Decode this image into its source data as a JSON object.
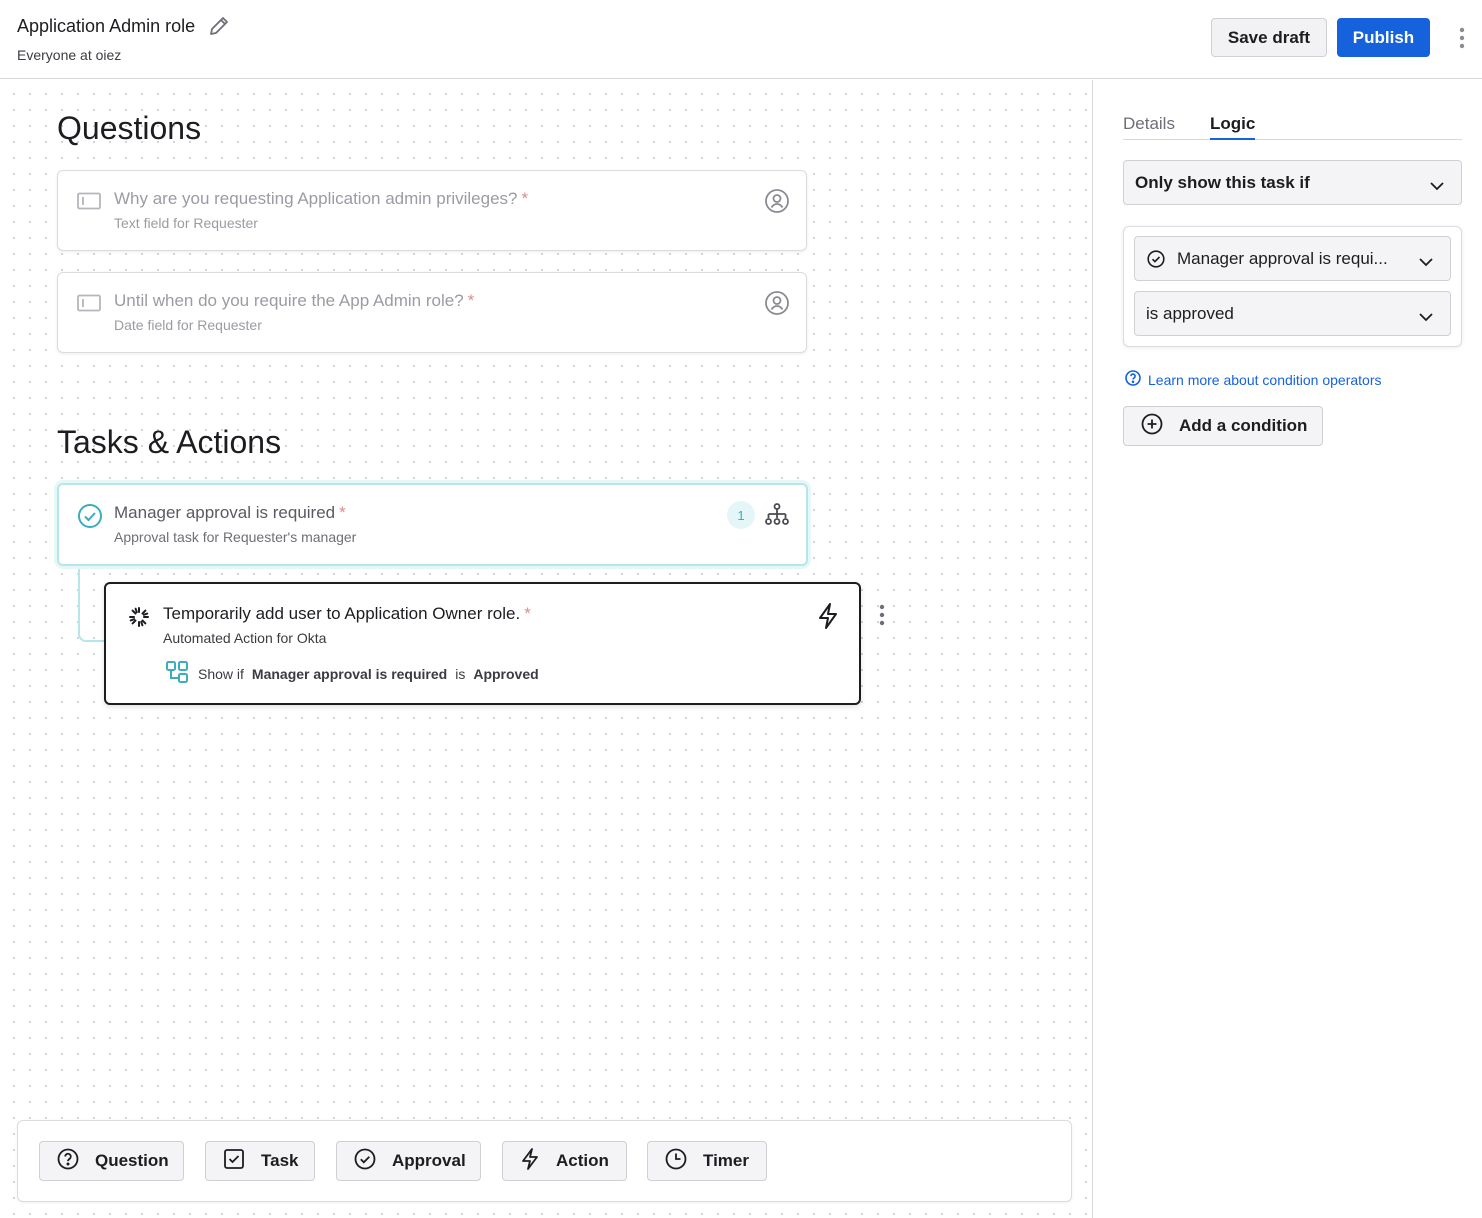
{
  "header": {
    "title": "Application Admin role",
    "subtitle": "Everyone at oiez",
    "save_draft_label": "Save draft",
    "publish_label": "Publish"
  },
  "canvas": {
    "questions_title": "Questions",
    "questions": [
      {
        "title": "Why are you requesting Application admin privileges?",
        "required": "*",
        "subtitle": "Text field for Requester"
      },
      {
        "title": "Until when do you require the App Admin role?",
        "required": "*",
        "subtitle": "Date field for Requester"
      }
    ],
    "tasks_title": "Tasks & Actions",
    "approval_task": {
      "title": "Manager approval is required",
      "required": "*",
      "subtitle": "Approval task for Requester's manager",
      "badge_count": "1"
    },
    "action_task": {
      "title": "Temporarily add user to Application Owner role.",
      "required": "*",
      "subtitle": "Automated Action for Okta",
      "condition_prefix": "Show if",
      "condition_subject": "Manager approval is required",
      "condition_operator": "is",
      "condition_value": "Approved"
    }
  },
  "toolbar": {
    "question_label": "Question",
    "task_label": "Task",
    "approval_label": "Approval",
    "action_label": "Action",
    "timer_label": "Timer"
  },
  "panel": {
    "tabs": [
      "Details",
      "Logic"
    ],
    "active_tab": "Logic",
    "visibility_select": "Only show this task if",
    "condition_subject_select": "Manager approval is requi...",
    "condition_operator_select": "is approved",
    "learn_more_link": "Learn more about condition operators",
    "add_condition_label": "Add a condition"
  },
  "colors": {
    "primary": "#1662dd",
    "approval_accent": "#3aaebd",
    "required": "#e08a8a"
  },
  "icons": {
    "edit": "pencil-icon",
    "more": "kebab-icon",
    "question_field": "text-field-icon",
    "requester": "user-circle-icon",
    "approval": "check-circle-icon",
    "hierarchy": "org-chart-icon",
    "okta": "okta-logo-icon",
    "action": "lightning-icon",
    "condition": "branch-icon",
    "help": "help-circle-icon",
    "add": "plus-circle-icon",
    "task": "checkbox-icon",
    "timer": "clock-icon",
    "chevron": "chevron-down-icon"
  }
}
